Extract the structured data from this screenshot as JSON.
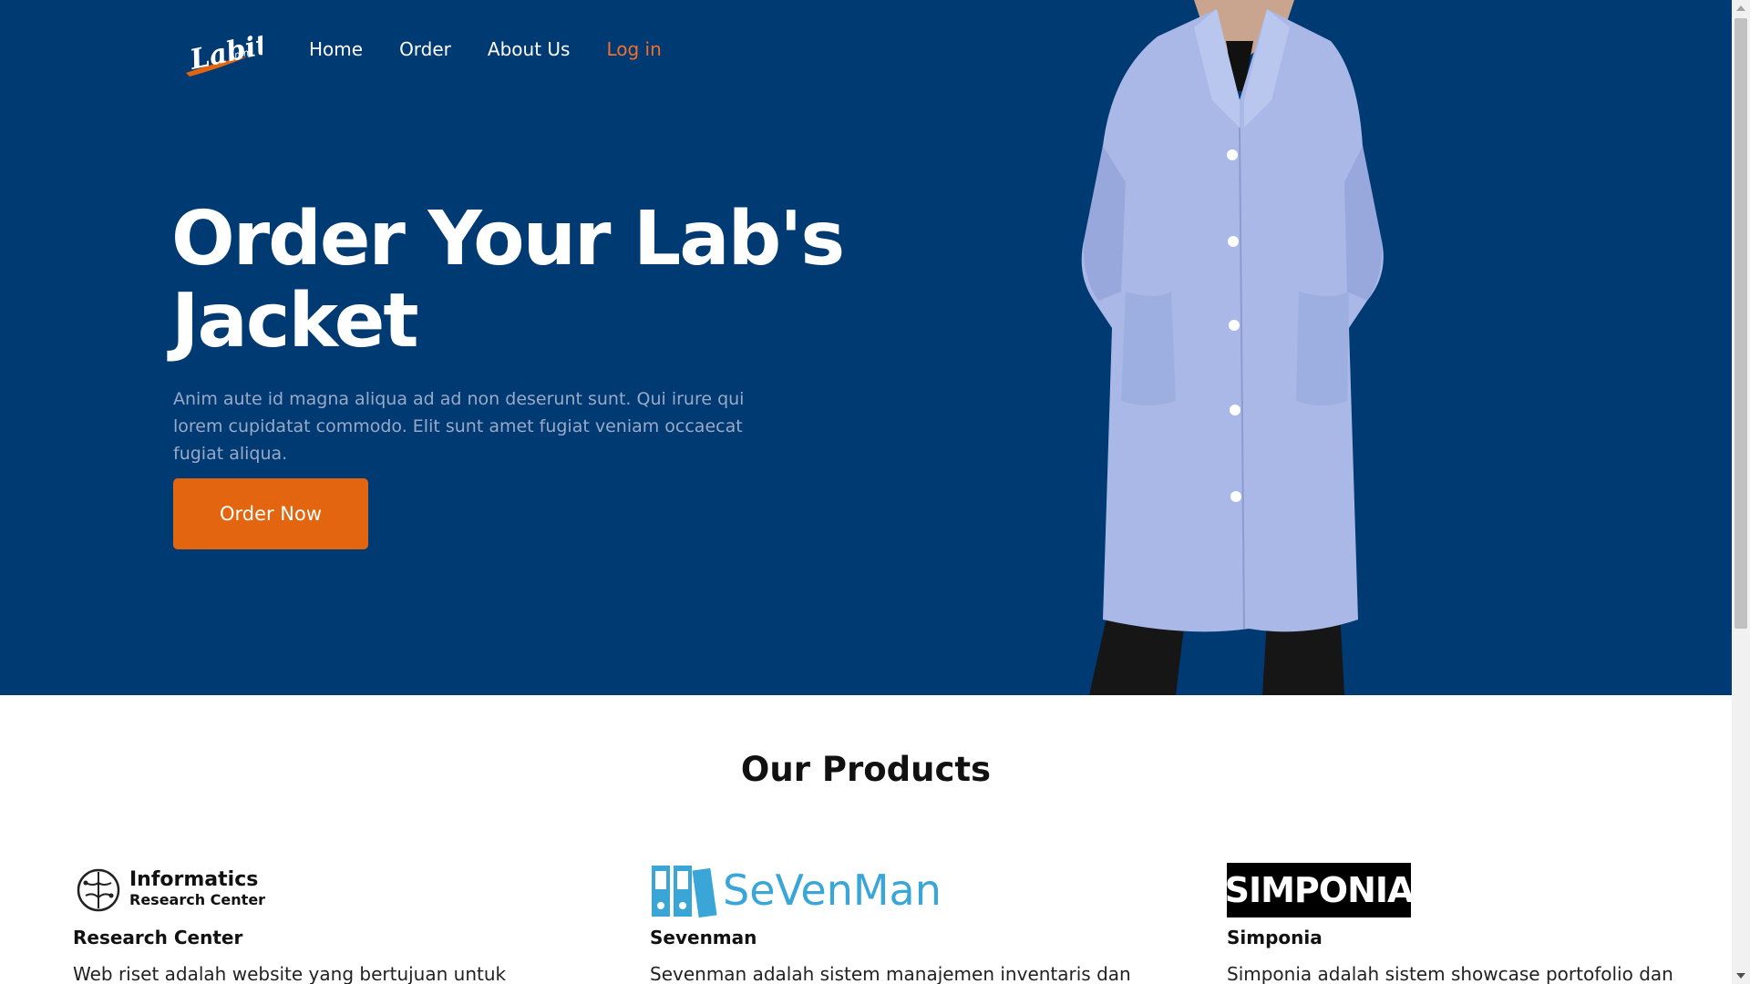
{
  "colors": {
    "hero_bg": "#003a73",
    "accent": "#e4650f",
    "login_link": "#f36e2c",
    "lead_text": "#9aa9c7",
    "coat": "#a9b8e6"
  },
  "header": {
    "logo_text": "Labit",
    "logo_subtext": "umm",
    "nav": [
      {
        "label": "Home"
      },
      {
        "label": "Order"
      },
      {
        "label": "About Us"
      },
      {
        "label": "Log in"
      }
    ]
  },
  "hero": {
    "headline": "Order Your Lab's Jacket",
    "lead": "Anim aute id magna aliqua ad ad non deserunt sunt. Qui irure qui lorem cupidatat commodo. Elit sunt amet fugiat veniam occaecat fugiat aliqua.",
    "cta_label": "Order Now",
    "image_icon": "lab-coat-person-image"
  },
  "products": {
    "title": "Our Products",
    "items": [
      {
        "brand_line1": "Informatics",
        "brand_line2": "Research Center",
        "brand_icon": "brain-icon",
        "title": "Research Center",
        "desc": "Web riset adalah website yang bertujuan untuk"
      },
      {
        "brand_line1": "SeVenMan",
        "brand_icon": "binders-icon",
        "title": "Sevenman",
        "desc": "Sevenman adalah sistem manajemen inventaris dan"
      },
      {
        "brand_line1": "SIMPONIA",
        "brand_icon": "simponia-logo",
        "title": "Simponia",
        "desc": "Simponia adalah sistem showcase portofolio dan"
      }
    ]
  }
}
